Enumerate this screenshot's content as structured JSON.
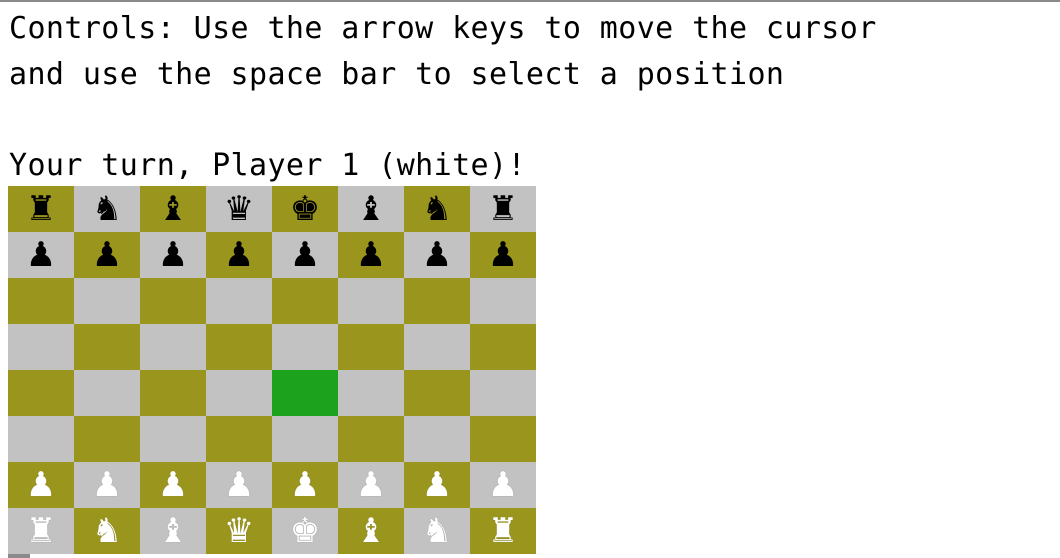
{
  "terminal": {
    "controls_line1": "Controls: Use the arrow keys to move the cursor",
    "controls_line2": "and use the space bar to select a position",
    "turn_message": "Your turn, Player 1 (white)!"
  },
  "board": {
    "colors": {
      "dark": "#9a951c",
      "light": "#c2c2c2",
      "cursor": "#1ca21c"
    },
    "cursor": {
      "row": 4,
      "col": 4
    },
    "ranks": [
      [
        {
          "piece": "rook",
          "color": "black",
          "glyph": "♜"
        },
        {
          "piece": "knight",
          "color": "black",
          "glyph": "♞"
        },
        {
          "piece": "bishop",
          "color": "black",
          "glyph": "♝"
        },
        {
          "piece": "queen",
          "color": "black",
          "glyph": "♛"
        },
        {
          "piece": "king",
          "color": "black",
          "glyph": "♚"
        },
        {
          "piece": "bishop",
          "color": "black",
          "glyph": "♝"
        },
        {
          "piece": "knight",
          "color": "black",
          "glyph": "♞"
        },
        {
          "piece": "rook",
          "color": "black",
          "glyph": "♜"
        }
      ],
      [
        {
          "piece": "pawn",
          "color": "black",
          "glyph": "♟"
        },
        {
          "piece": "pawn",
          "color": "black",
          "glyph": "♟"
        },
        {
          "piece": "pawn",
          "color": "black",
          "glyph": "♟"
        },
        {
          "piece": "pawn",
          "color": "black",
          "glyph": "♟"
        },
        {
          "piece": "pawn",
          "color": "black",
          "glyph": "♟"
        },
        {
          "piece": "pawn",
          "color": "black",
          "glyph": "♟"
        },
        {
          "piece": "pawn",
          "color": "black",
          "glyph": "♟"
        },
        {
          "piece": "pawn",
          "color": "black",
          "glyph": "♟"
        }
      ],
      [
        null,
        null,
        null,
        null,
        null,
        null,
        null,
        null
      ],
      [
        null,
        null,
        null,
        null,
        null,
        null,
        null,
        null
      ],
      [
        null,
        null,
        null,
        null,
        null,
        null,
        null,
        null
      ],
      [
        null,
        null,
        null,
        null,
        null,
        null,
        null,
        null
      ],
      [
        {
          "piece": "pawn",
          "color": "white",
          "glyph": "♟"
        },
        {
          "piece": "pawn",
          "color": "white",
          "glyph": "♟"
        },
        {
          "piece": "pawn",
          "color": "white",
          "glyph": "♟"
        },
        {
          "piece": "pawn",
          "color": "white",
          "glyph": "♟"
        },
        {
          "piece": "pawn",
          "color": "white",
          "glyph": "♟"
        },
        {
          "piece": "pawn",
          "color": "white",
          "glyph": "♟"
        },
        {
          "piece": "pawn",
          "color": "white",
          "glyph": "♟"
        },
        {
          "piece": "pawn",
          "color": "white",
          "glyph": "♟"
        }
      ],
      [
        {
          "piece": "rook",
          "color": "white",
          "glyph": "♜"
        },
        {
          "piece": "knight",
          "color": "white",
          "glyph": "♞"
        },
        {
          "piece": "bishop",
          "color": "white",
          "glyph": "♝"
        },
        {
          "piece": "queen",
          "color": "white",
          "glyph": "♛"
        },
        {
          "piece": "king",
          "color": "white",
          "glyph": "♚"
        },
        {
          "piece": "bishop",
          "color": "white",
          "glyph": "♝"
        },
        {
          "piece": "knight",
          "color": "white",
          "glyph": "♞"
        },
        {
          "piece": "rook",
          "color": "white",
          "glyph": "♜"
        }
      ]
    ]
  }
}
